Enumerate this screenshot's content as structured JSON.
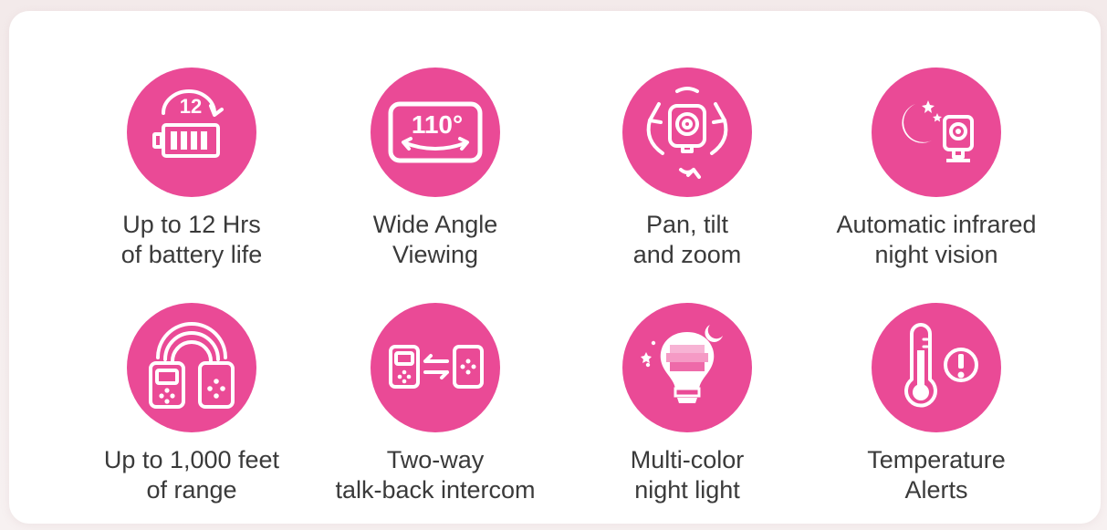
{
  "accent_color": "#ea4a96",
  "features": [
    {
      "icon": "battery-icon",
      "icon_text": "12",
      "line1": "Up to 12 Hrs",
      "line2": "of battery life"
    },
    {
      "icon": "wide-angle-icon",
      "icon_text": "110°",
      "line1": "Wide Angle",
      "line2": "Viewing"
    },
    {
      "icon": "pan-tilt-zoom-icon",
      "line1": "Pan, tilt",
      "line2": "and zoom"
    },
    {
      "icon": "night-vision-icon",
      "line1": "Automatic infrared",
      "line2": "night vision"
    },
    {
      "icon": "range-icon",
      "line1": "Up to 1,000 feet",
      "line2": "of range"
    },
    {
      "icon": "intercom-icon",
      "line1": "Two-way",
      "line2": "talk-back intercom"
    },
    {
      "icon": "night-light-icon",
      "line1": "Multi-color",
      "line2": "night light"
    },
    {
      "icon": "thermometer-alert-icon",
      "line1": "Temperature",
      "line2": "Alerts"
    }
  ]
}
